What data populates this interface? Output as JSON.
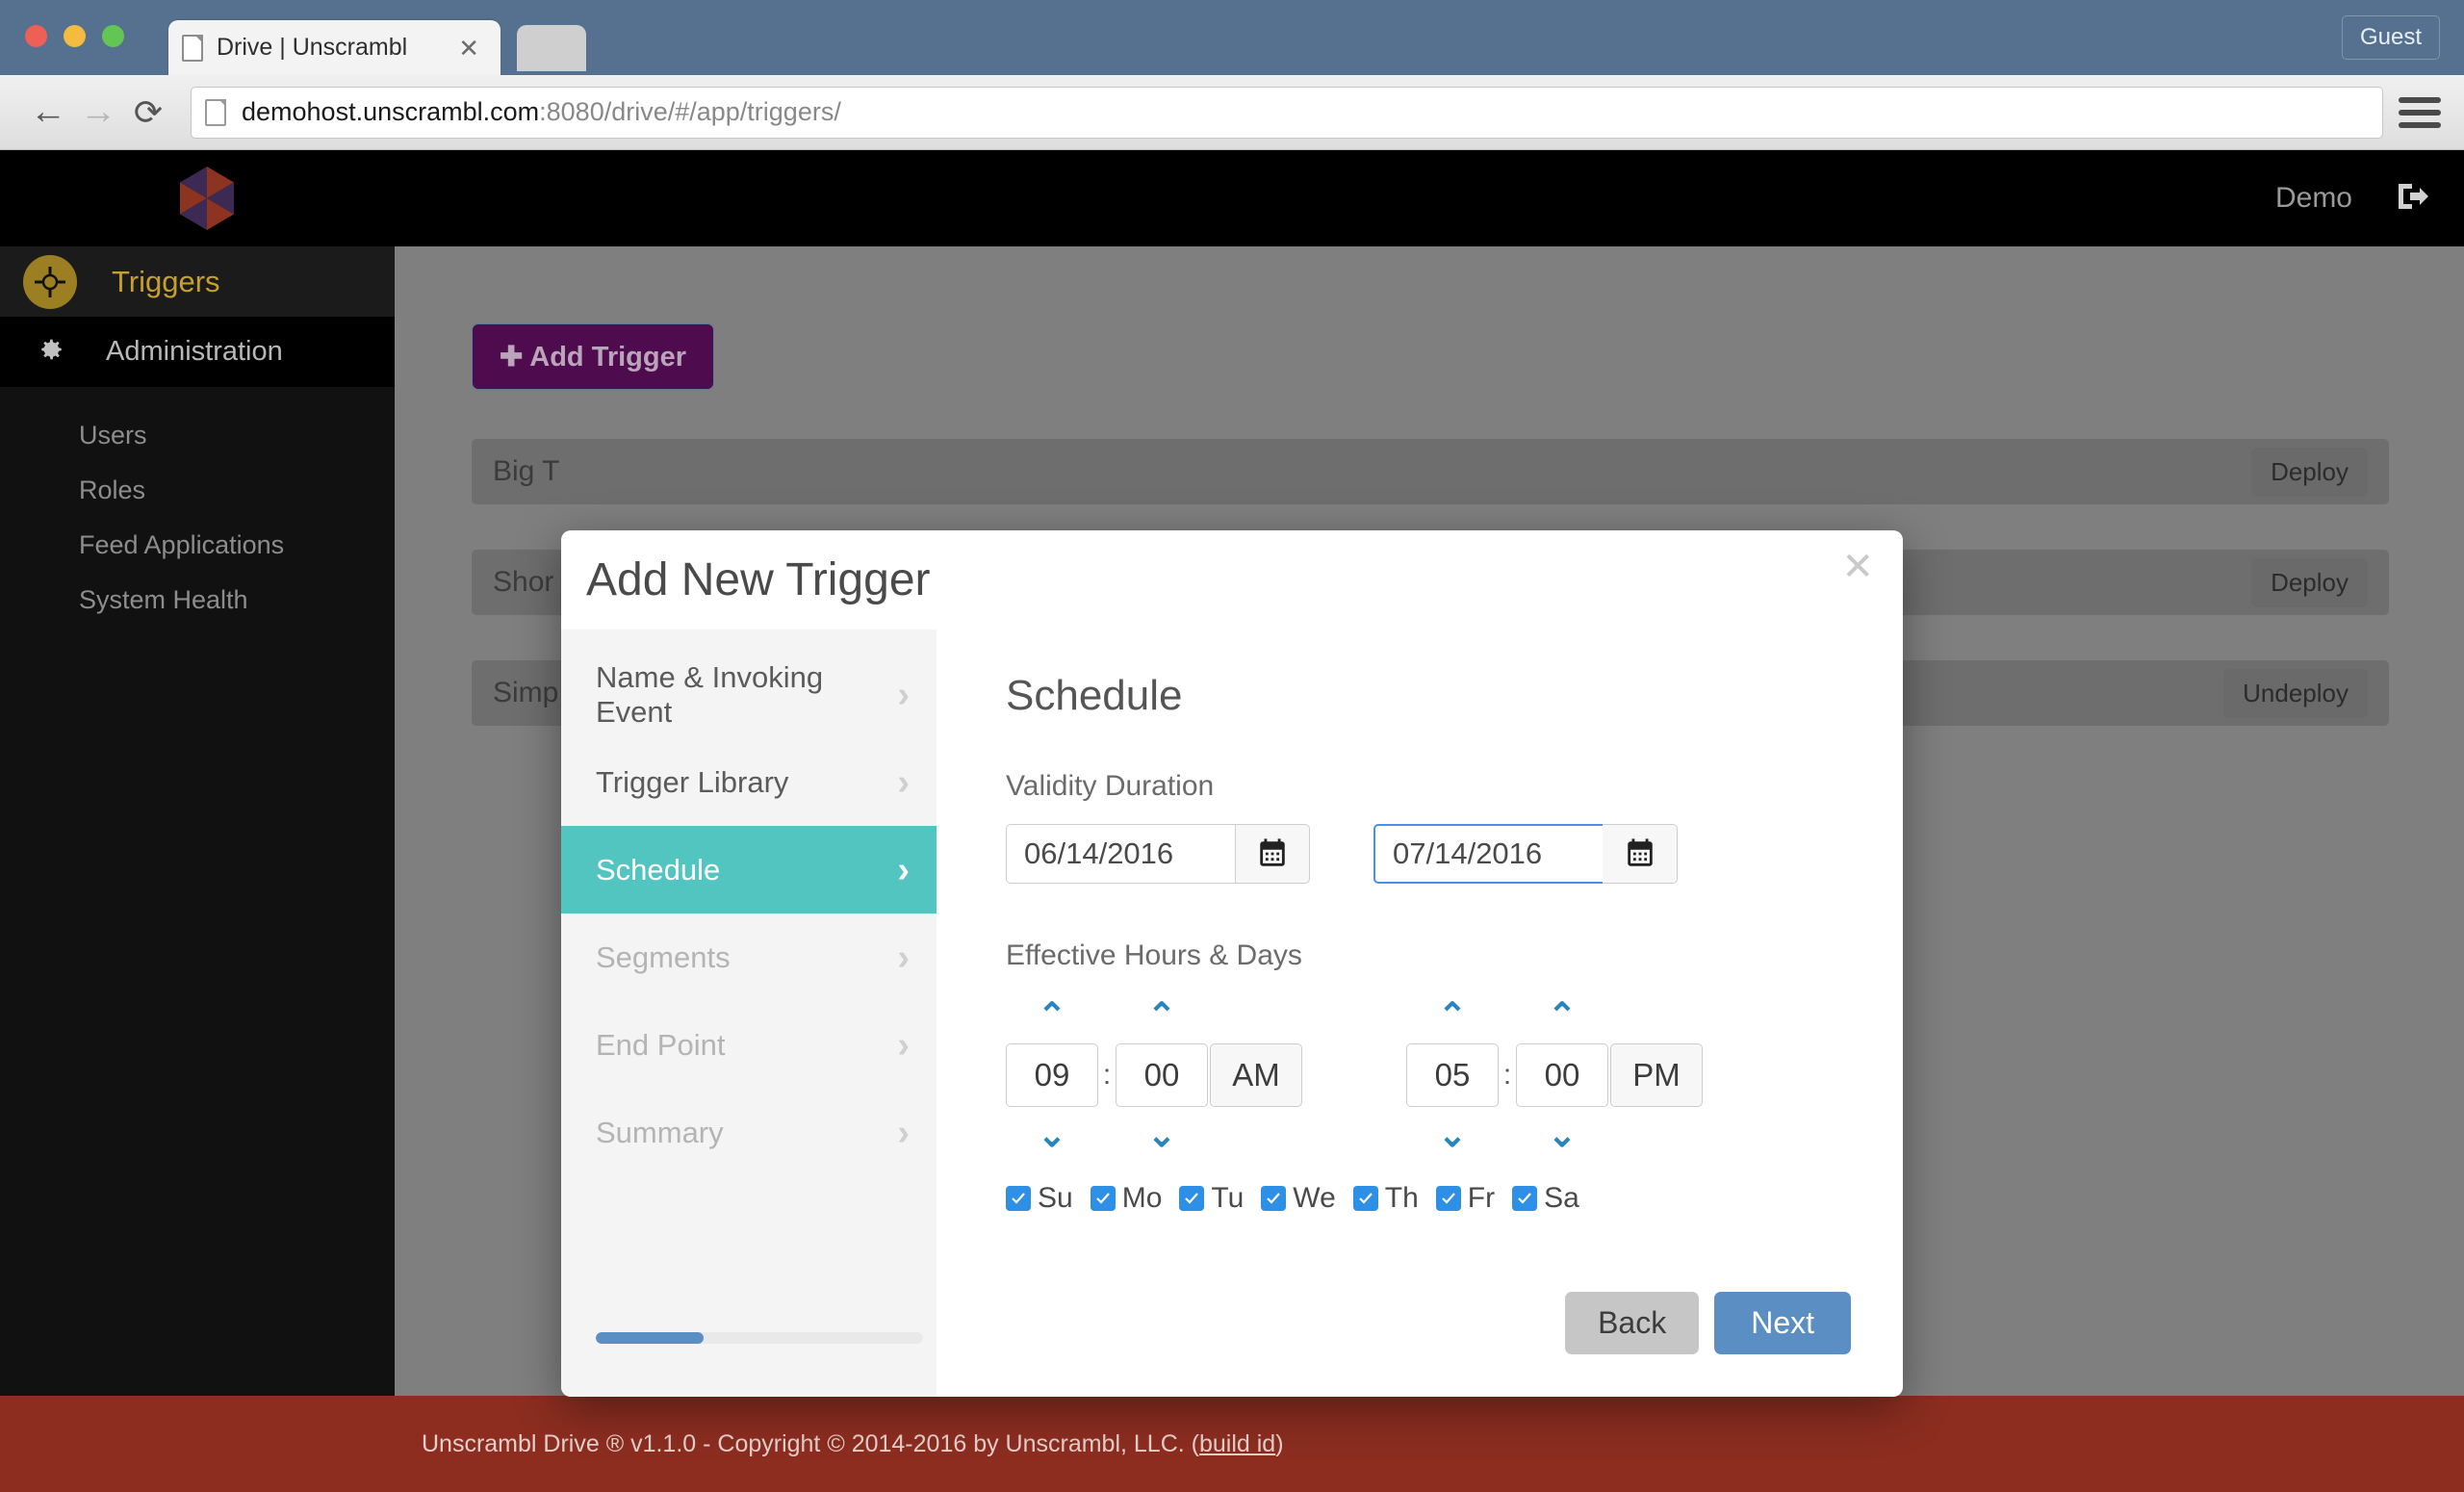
{
  "browser": {
    "tab_title": "Drive | Unscrambl",
    "tab_close": "✕",
    "guest_label": "Guest",
    "url_host": "demohost.unscrambl.com",
    "url_path": ":8080/drive/#/app/triggers/",
    "back_icon": "←",
    "forward_icon": "→",
    "reload_icon": "⟳"
  },
  "topnav": {
    "user": "Demo",
    "signout_icon": "sign-out-icon"
  },
  "sidebar": {
    "triggers_label": "Triggers",
    "admin_label": "Administration",
    "sub_items": [
      {
        "label": "Users"
      },
      {
        "label": "Roles"
      },
      {
        "label": "Feed Applications"
      },
      {
        "label": "System Health"
      }
    ]
  },
  "content": {
    "add_trigger_label": "✚ Add Trigger",
    "rows": [
      {
        "name": "Big T",
        "action": "Deploy"
      },
      {
        "name": "Shor",
        "action": "Deploy"
      },
      {
        "name": "Simp",
        "action": "Undeploy"
      }
    ]
  },
  "footer": {
    "text": "Unscrambl Drive ® v1.1.0 - Copyright © 2014-2016 by Unscrambl, LLC. (",
    "link": "build id",
    "text_end": ")"
  },
  "modal": {
    "title": "Add New Trigger",
    "close": "✕",
    "steps": [
      {
        "label": "Name & Invoking Event",
        "state": "enabled"
      },
      {
        "label": "Trigger Library",
        "state": "enabled"
      },
      {
        "label": "Schedule",
        "state": "active"
      },
      {
        "label": "Segments",
        "state": "disabled"
      },
      {
        "label": "End Point",
        "state": "disabled"
      },
      {
        "label": "Summary",
        "state": "disabled"
      }
    ],
    "progress_percent": 33,
    "pane": {
      "heading": "Schedule",
      "validity_label": "Validity Duration",
      "start_date": "06/14/2016",
      "end_date": "07/14/2016",
      "hours_label": "Effective Hours & Days",
      "start_hour": "09",
      "start_minute": "00",
      "start_meridiem": "AM",
      "end_hour": "05",
      "end_minute": "00",
      "end_meridiem": "PM",
      "days": [
        {
          "label": "Su",
          "checked": true
        },
        {
          "label": "Mo",
          "checked": true
        },
        {
          "label": "Tu",
          "checked": true
        },
        {
          "label": "We",
          "checked": true
        },
        {
          "label": "Th",
          "checked": true
        },
        {
          "label": "Fr",
          "checked": true
        },
        {
          "label": "Sa",
          "checked": true
        }
      ],
      "up_arrow": "⌃",
      "down_arrow": "⌄",
      "time_separator": ":"
    },
    "back_label": "Back",
    "next_label": "Next"
  },
  "colors": {
    "accent_teal": "#53c5c0",
    "accent_blue": "#5b8fc4",
    "brand_purple": "#4e0b4e",
    "footer_red": "#8c2d20",
    "triggers_gold": "#c79f2b"
  }
}
